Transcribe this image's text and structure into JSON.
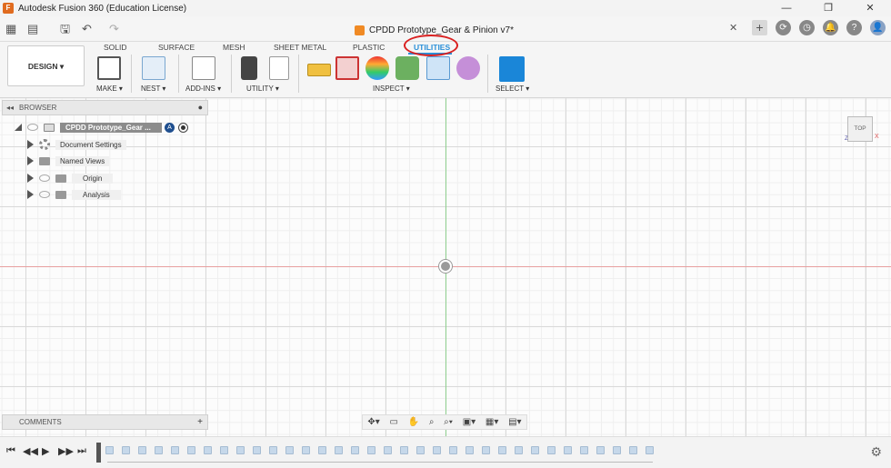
{
  "window": {
    "title": "Autodesk Fusion 360 (Education License)",
    "app_icon": "F",
    "minimize": "—",
    "maximize": "❐",
    "close": "✕"
  },
  "document": {
    "tab_title": "CPDD Prototype_Gear & Pinion v7*",
    "close": "✕"
  },
  "quickbar": {
    "grid_icon": "▦",
    "file_icon": "▤",
    "save_icon": "🖫",
    "undo_icon": "↶",
    "redo_icon": "↷",
    "right_icons": [
      "+",
      "⟳",
      "◷",
      "🔔",
      "?",
      "👤"
    ]
  },
  "toolbar": {
    "tabs": [
      "SOLID",
      "SURFACE",
      "MESH",
      "SHEET METAL",
      "PLASTIC",
      "UTILITIES"
    ],
    "active_tab": "UTILITIES",
    "workspace": "DESIGN ▾",
    "groups": {
      "make": "MAKE ▾",
      "nest": "NEST ▾",
      "addins": "ADD-INS ▾",
      "utility": "UTILITY ▾",
      "inspect": "INSPECT ▾",
      "select": "SELECT ▾"
    }
  },
  "browser": {
    "header": "BROWSER",
    "collapse": "◂◂",
    "pin": "●",
    "root_label": "CPDD Prototype_Gear ...",
    "badge": "A",
    "items": [
      "Document Settings",
      "Named Views",
      "Origin",
      "Analysis"
    ]
  },
  "comments": {
    "label": "COMMENTS",
    "add": "+"
  },
  "viewcube": {
    "face": "TOP",
    "x_label": "X",
    "z_label": "Z"
  },
  "navbar": {
    "icons": [
      "✥▾",
      "▭",
      "✋",
      "⌕",
      "⌕▾",
      "▣▾",
      "▦▾",
      "▤▾"
    ]
  },
  "timeline": {
    "controls": [
      "⏮",
      "◀◀",
      "▶",
      "▶▶",
      "⏭"
    ],
    "settings": "⚙"
  },
  "colors": {
    "accent": "#2a8fd8",
    "annotation": "#d92020",
    "axis_green": "#8fd08f",
    "axis_red": "#e8a0a0"
  }
}
